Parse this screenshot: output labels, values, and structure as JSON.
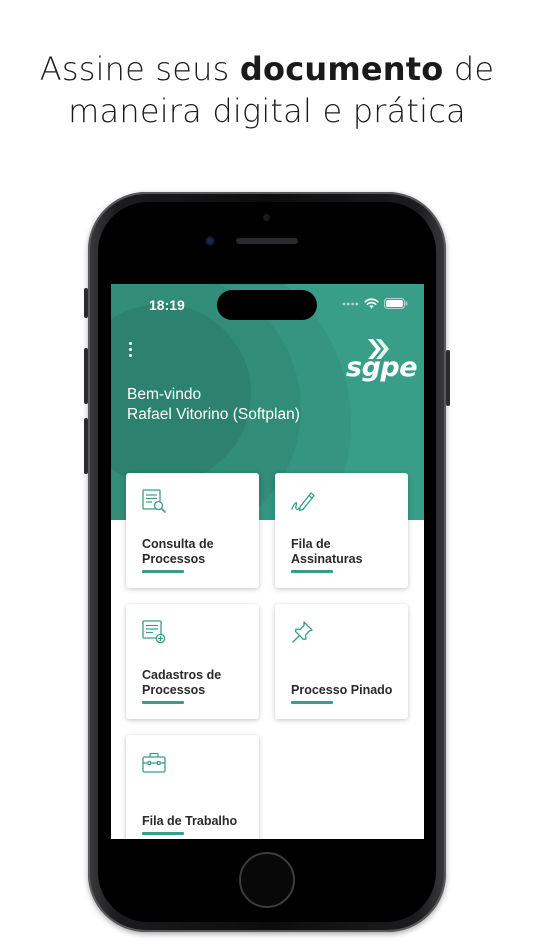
{
  "headline": {
    "prefix": "Assine seus ",
    "bold": "documento",
    "suffix": " de",
    "line2": "maneira digital e prática"
  },
  "status_bar": {
    "time": "18:19"
  },
  "app": {
    "logo_text": "sgpe",
    "welcome_line1": "Bem-vindo",
    "welcome_line2": "Rafael Vitorino (Softplan)",
    "accent_color": "#389e87"
  },
  "cards": [
    {
      "line1": "Consulta de",
      "line2": "Processos",
      "icon": "document-search-icon"
    },
    {
      "line1": "Fila de",
      "line2": "Assinaturas",
      "icon": "signature-pen-icon"
    },
    {
      "line1": "Cadastros de",
      "line2": "Processos",
      "icon": "document-add-icon"
    },
    {
      "line1": "",
      "line2": "Processo Pinado",
      "icon": "pin-icon"
    },
    {
      "line1": "",
      "line2": "Fila de Trabalho",
      "icon": "briefcase-icon"
    }
  ]
}
